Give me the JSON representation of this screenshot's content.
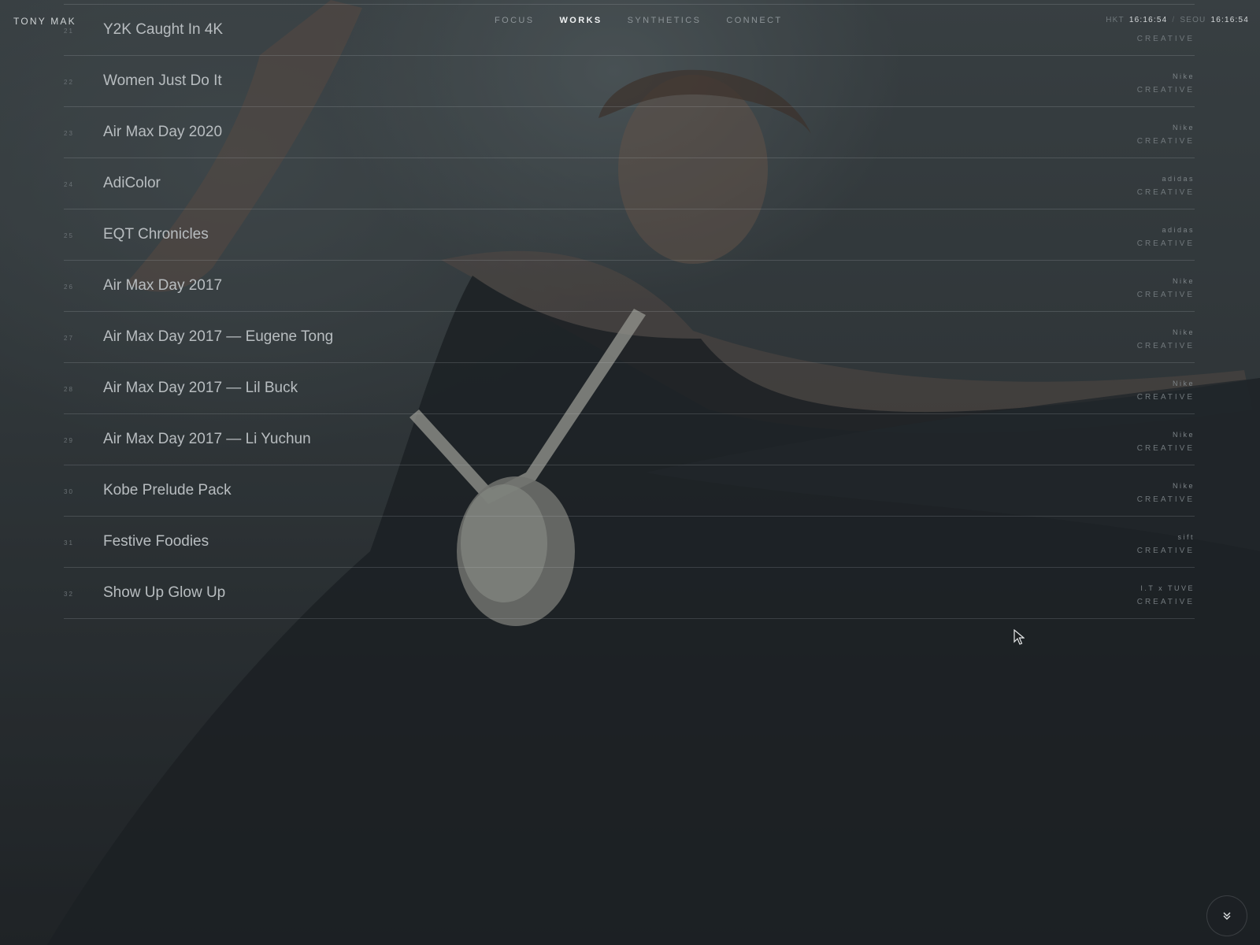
{
  "header": {
    "brand": "TONY MAK",
    "nav": [
      {
        "label": "FOCUS",
        "active": false
      },
      {
        "label": "WORKS",
        "active": true
      },
      {
        "label": "SYNTHETICS",
        "active": false
      },
      {
        "label": "CONNECT",
        "active": false
      }
    ],
    "clock": {
      "city1": "HKT",
      "time1": "16:16:54",
      "separator": "/",
      "city2": "SEOU",
      "time2": "16:16:54"
    }
  },
  "works": [
    {
      "num": "21",
      "title": "Y2K Caught In 4K",
      "client": "",
      "category": "CREATIVE"
    },
    {
      "num": "22",
      "title": "Women Just Do It",
      "client": "Nike",
      "category": "CREATIVE"
    },
    {
      "num": "23",
      "title": "Air Max Day 2020",
      "client": "Nike",
      "category": "CREATIVE"
    },
    {
      "num": "24",
      "title": "AdiColor",
      "client": "adidas",
      "category": "CREATIVE"
    },
    {
      "num": "25",
      "title": "EQT Chronicles",
      "client": "adidas",
      "category": "CREATIVE"
    },
    {
      "num": "26",
      "title": "Air Max Day 2017",
      "client": "Nike",
      "category": "CREATIVE"
    },
    {
      "num": "27",
      "title": "Air Max Day 2017 — Eugene Tong",
      "client": "Nike",
      "category": "CREATIVE"
    },
    {
      "num": "28",
      "title": "Air Max Day 2017 — Lil Buck",
      "client": "Nike",
      "category": "CREATIVE"
    },
    {
      "num": "29",
      "title": "Air Max Day 2017 — Li Yuchun",
      "client": "Nike",
      "category": "CREATIVE"
    },
    {
      "num": "30",
      "title": "Kobe Prelude Pack",
      "client": "Nike",
      "category": "CREATIVE"
    },
    {
      "num": "31",
      "title": "Festive Foodies",
      "client": "sift",
      "category": "CREATIVE"
    },
    {
      "num": "32",
      "title": "Show Up Glow Up",
      "client": "I.T x TUVE",
      "category": "CREATIVE"
    }
  ],
  "icons": {
    "cursor": "mouse-pointer-icon",
    "scroll": "double-chevron-down-icon"
  }
}
